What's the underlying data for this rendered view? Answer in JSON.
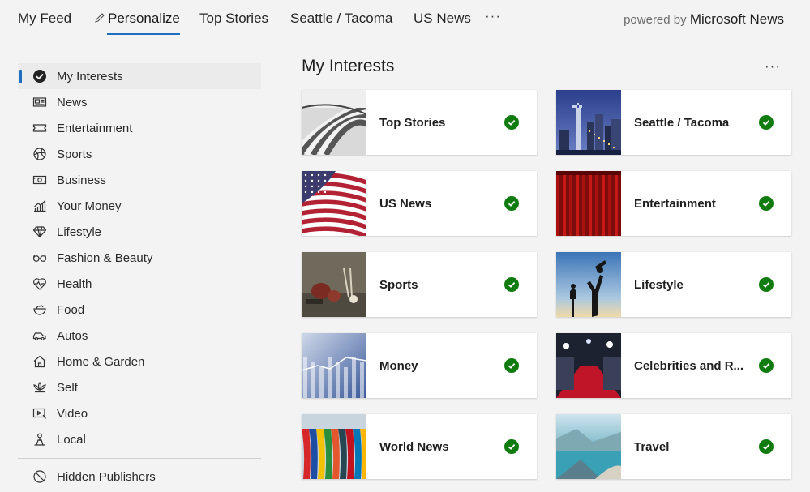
{
  "nav": {
    "tabs": [
      {
        "label": "My Feed"
      },
      {
        "label": "Personalize"
      },
      {
        "label": "Top Stories"
      },
      {
        "label": "Seattle / Tacoma"
      },
      {
        "label": "US News"
      }
    ],
    "more": "···",
    "powered_prefix": "powered by",
    "powered_brand": "Microsoft News"
  },
  "sidebar": {
    "items": [
      {
        "label": "My Interests",
        "icon": "check-circle-icon",
        "selected": true
      },
      {
        "label": "News",
        "icon": "newspaper-icon"
      },
      {
        "label": "Entertainment",
        "icon": "ticket-icon"
      },
      {
        "label": "Sports",
        "icon": "ball-icon"
      },
      {
        "label": "Business",
        "icon": "money-icon"
      },
      {
        "label": "Your Money",
        "icon": "chart-icon"
      },
      {
        "label": "Lifestyle",
        "icon": "diamond-icon"
      },
      {
        "label": "Fashion & Beauty",
        "icon": "glasses-icon"
      },
      {
        "label": "Health",
        "icon": "heart-pulse-icon"
      },
      {
        "label": "Food",
        "icon": "bowl-icon"
      },
      {
        "label": "Autos",
        "icon": "car-icon"
      },
      {
        "label": "Home & Garden",
        "icon": "home-icon"
      },
      {
        "label": "Self",
        "icon": "lotus-icon"
      },
      {
        "label": "Video",
        "icon": "video-icon"
      },
      {
        "label": "Local",
        "icon": "location-icon"
      }
    ],
    "hidden": {
      "label": "Hidden Publishers",
      "icon": "block-icon"
    }
  },
  "main": {
    "title": "My Interests",
    "more": "···",
    "cards": [
      {
        "label": "Top Stories",
        "image": "newspapers"
      },
      {
        "label": "Seattle / Tacoma",
        "image": "city-skyline"
      },
      {
        "label": "US News",
        "image": "us-flag"
      },
      {
        "label": "Entertainment",
        "image": "red-curtain"
      },
      {
        "label": "Sports",
        "image": "sports-gear"
      },
      {
        "label": "Lifestyle",
        "image": "silhouettes"
      },
      {
        "label": "Money",
        "image": "finance"
      },
      {
        "label": "Celebrities and R...",
        "image": "red-carpet"
      },
      {
        "label": "World News",
        "image": "world-flags"
      },
      {
        "label": "Travel",
        "image": "fjord"
      }
    ]
  },
  "colors": {
    "accent": "#1e6fc2",
    "check": "#107c10"
  }
}
